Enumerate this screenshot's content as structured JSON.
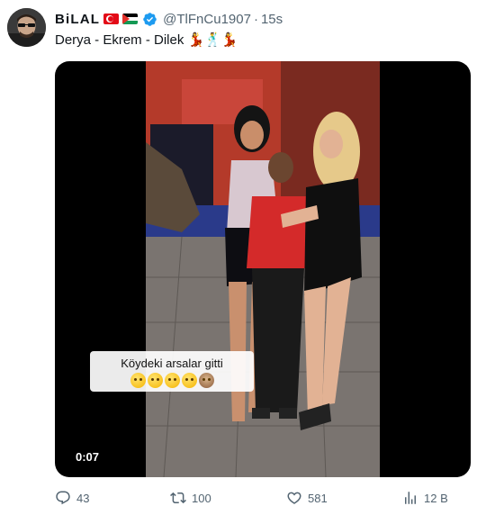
{
  "cropped_top_text": "",
  "tweet": {
    "author": {
      "name": "BiLAL",
      "handle": "@TlFnCu1907",
      "verified": true,
      "flags": [
        "turkey-flag",
        "palestine-flag"
      ]
    },
    "time": "15s",
    "separator": "·",
    "text": "Derya - Ekrem - Dilek 💃🕺💃",
    "media": {
      "type": "video",
      "duration": "0:07",
      "caption": "Köydeki arsalar gitti",
      "caption_emojis": [
        "grin-emoji",
        "grin-sweat-emoji",
        "unamused-emoji",
        "grin-emoji",
        "see-no-evil-monkey-emoji"
      ]
    },
    "actions": {
      "replies": "43",
      "reposts": "100",
      "likes": "581",
      "views": "12 B"
    }
  },
  "colors": {
    "text": "#0f1419",
    "secondary": "#536471",
    "verified": "#1d9bf0",
    "background": "#ffffff"
  }
}
